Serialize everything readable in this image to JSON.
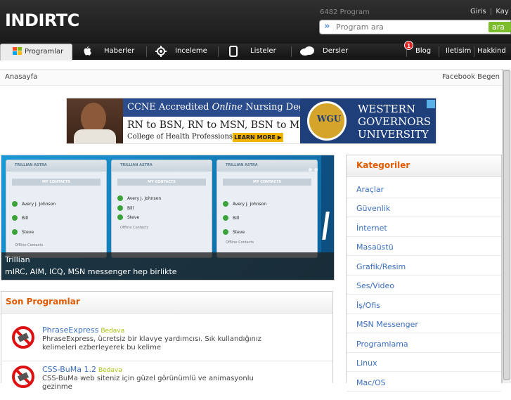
{
  "header": {
    "logo": "INDIRTC",
    "program_count": "6482 Program",
    "login": "Giris",
    "separator": "|",
    "register": "Kay",
    "search_placeholder": "Program ara",
    "search_button": "ara"
  },
  "nav": {
    "items": [
      {
        "label": "Programlar",
        "icon": "windows-icon"
      },
      {
        "label": "Haberler",
        "icon": "apple-icon"
      },
      {
        "label": "Inceleme",
        "icon": "gear-icon"
      },
      {
        "label": "Listeler",
        "icon": "phone-icon"
      },
      {
        "label": "Dersler",
        "icon": "cloud-icon"
      },
      {
        "label": "Blog",
        "icon": ""
      },
      {
        "label": "Iletisim",
        "icon": ""
      },
      {
        "label": "Hakkind",
        "icon": ""
      }
    ],
    "notification_count": "1"
  },
  "breadcrumb": {
    "home": "Anasayfa",
    "facebook": "Facebook Begen"
  },
  "ad": {
    "headline": "CCNE Accredited",
    "headline_italic": "Online",
    "headline_end": "Nursing Degrees.",
    "line2": "RN to BSN, RN to MSN, BSN to MSN",
    "line3": "College of Health Professions",
    "cta": "LEARN MORE ▶",
    "seal": "WGU",
    "brand_line1": "WESTERN",
    "brand_line2": "GOVERNORS",
    "brand_line3": "UNIVERSITY"
  },
  "slider": {
    "title": "Trillian",
    "subtitle": "mIRC, AIM, ICQ, MSN messenger hep birlikte",
    "window_brand": "TRILLIAN ASTRA",
    "contacts_header": "MY CONTACTS",
    "contacts": [
      "Avery J. Johnson",
      "Bill",
      "Steve"
    ],
    "offline": "Offline Contacts"
  },
  "son_programlar": {
    "title": "Son Programlar",
    "items": [
      {
        "name": "PhraseExpress",
        "tag": "Bedava",
        "desc": "PhraseExpress, ücretsiz bir klavye yardımcısı. Sık kullandığınız kelimeleri ezberleyerek bu kelime"
      },
      {
        "name": "CSS-BuMa 1.2",
        "tag": "Bedava",
        "desc": "CSS-BuMa web siteniz için güzel görünümlü ve animasyonlu gezinme"
      }
    ]
  },
  "kategoriler": {
    "title": "Kategoriler",
    "items": [
      "Araçlar",
      "Güvenlik",
      "İnternet",
      "Masaüstü",
      "Grafik/Resim",
      "Ses/Video",
      "İş/Ofis",
      "MSN Messenger",
      "Programlama",
      "Linux",
      "Mac/OS"
    ]
  },
  "colors": {
    "accent_orange": "#e05a00",
    "link_blue": "#3a6fbf",
    "free_green": "#a5c410",
    "search_green": "#7cbd2e"
  }
}
